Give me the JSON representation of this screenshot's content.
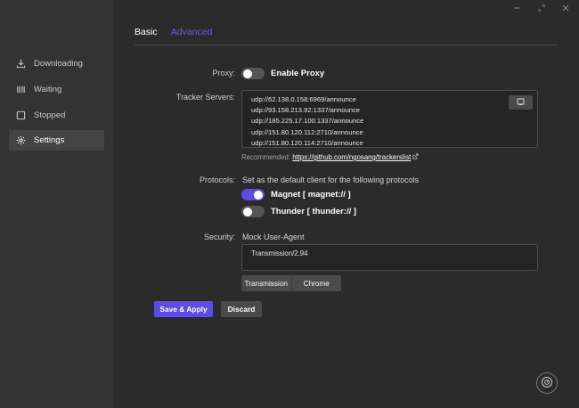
{
  "sidebar": {
    "items": [
      {
        "label": "Downloading",
        "icon": "download-icon"
      },
      {
        "label": "Waiting",
        "icon": "pause-icon"
      },
      {
        "label": "Stopped",
        "icon": "stop-icon"
      },
      {
        "label": "Settings",
        "icon": "gear-icon",
        "active": true
      }
    ]
  },
  "tabs": {
    "basic": "Basic",
    "advanced": "Advanced"
  },
  "proxy": {
    "label": "Proxy:",
    "toggle_label": "Enable Proxy",
    "enabled": false
  },
  "tracker": {
    "label": "Tracker Servers:",
    "servers": [
      "udp://62.138.0.158:6969/announce",
      "udp://93.158.213.92:1337/announce",
      "udp://185.225.17.100:1337/announce",
      "udp://151.80.120.112:2710/announce",
      "udp://151.80.120.114:2710/announce"
    ],
    "recommended_label": "Recommended:",
    "recommended_link": "https://github.com/ngosang/trackerslist"
  },
  "protocols": {
    "label": "Protocols:",
    "description": "Set as the default client for the following protocols",
    "magnet_label": "Magnet [ magnet:// ]",
    "magnet_enabled": true,
    "thunder_label": "Thunder [ thunder:// ]",
    "thunder_enabled": false
  },
  "security": {
    "label": "Security:",
    "mock_ua_label": "Mock User-Agent",
    "user_agent": "Transmission/2.94",
    "preset_transmission": "Transmission",
    "preset_chrome": "Chrome"
  },
  "actions": {
    "save": "Save & Apply",
    "discard": "Discard"
  },
  "colors": {
    "accent": "#5b4de0",
    "sidebar_bg": "#333333",
    "main_bg": "#2b2b2b"
  }
}
